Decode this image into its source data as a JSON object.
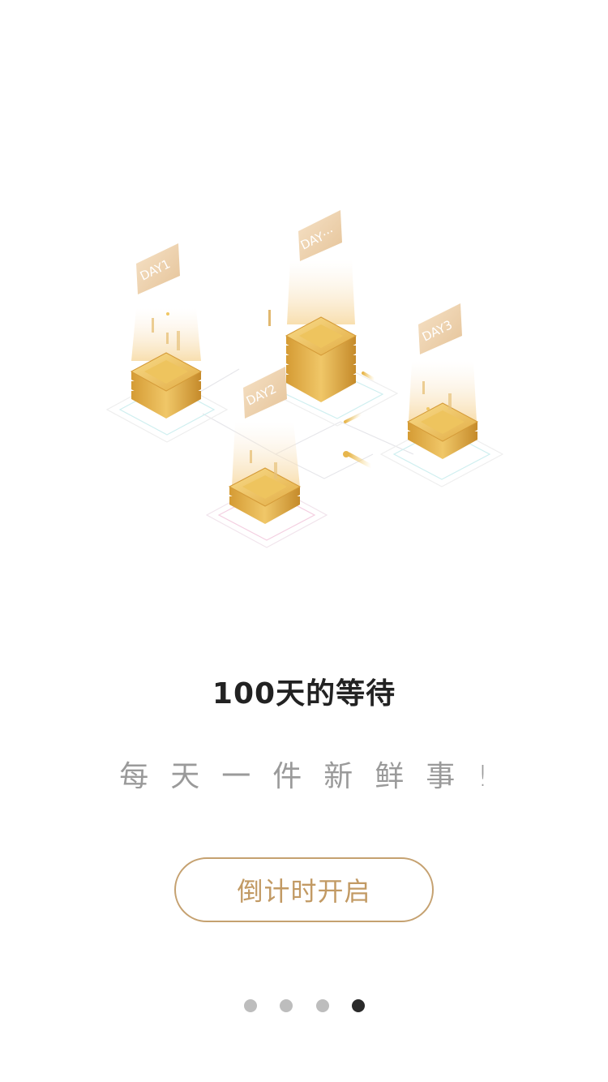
{
  "illustration": {
    "icon": "gold-coin-stacks-illustration",
    "tags": [
      "DAY1",
      "DAY2",
      "DAY3",
      "DAY···"
    ],
    "colors": {
      "gold_light": "#f7d780",
      "gold_mid": "#e7b64d",
      "gold_dark": "#c78d2c",
      "tag_light": "#f6e2c7",
      "tag_dark": "#e7c79e"
    }
  },
  "onboarding": {
    "title": "100天的等待",
    "subtitle": "每天一件新鲜事!",
    "cta_label": "倒计时开启"
  },
  "pager": {
    "total": 4,
    "current": 4
  },
  "colors": {
    "accent": "#c5a170",
    "title": "#222222",
    "subtitle": "#9a9a9a",
    "dot_inactive": "#bdbdbd",
    "dot_active": "#2a2a2a"
  }
}
